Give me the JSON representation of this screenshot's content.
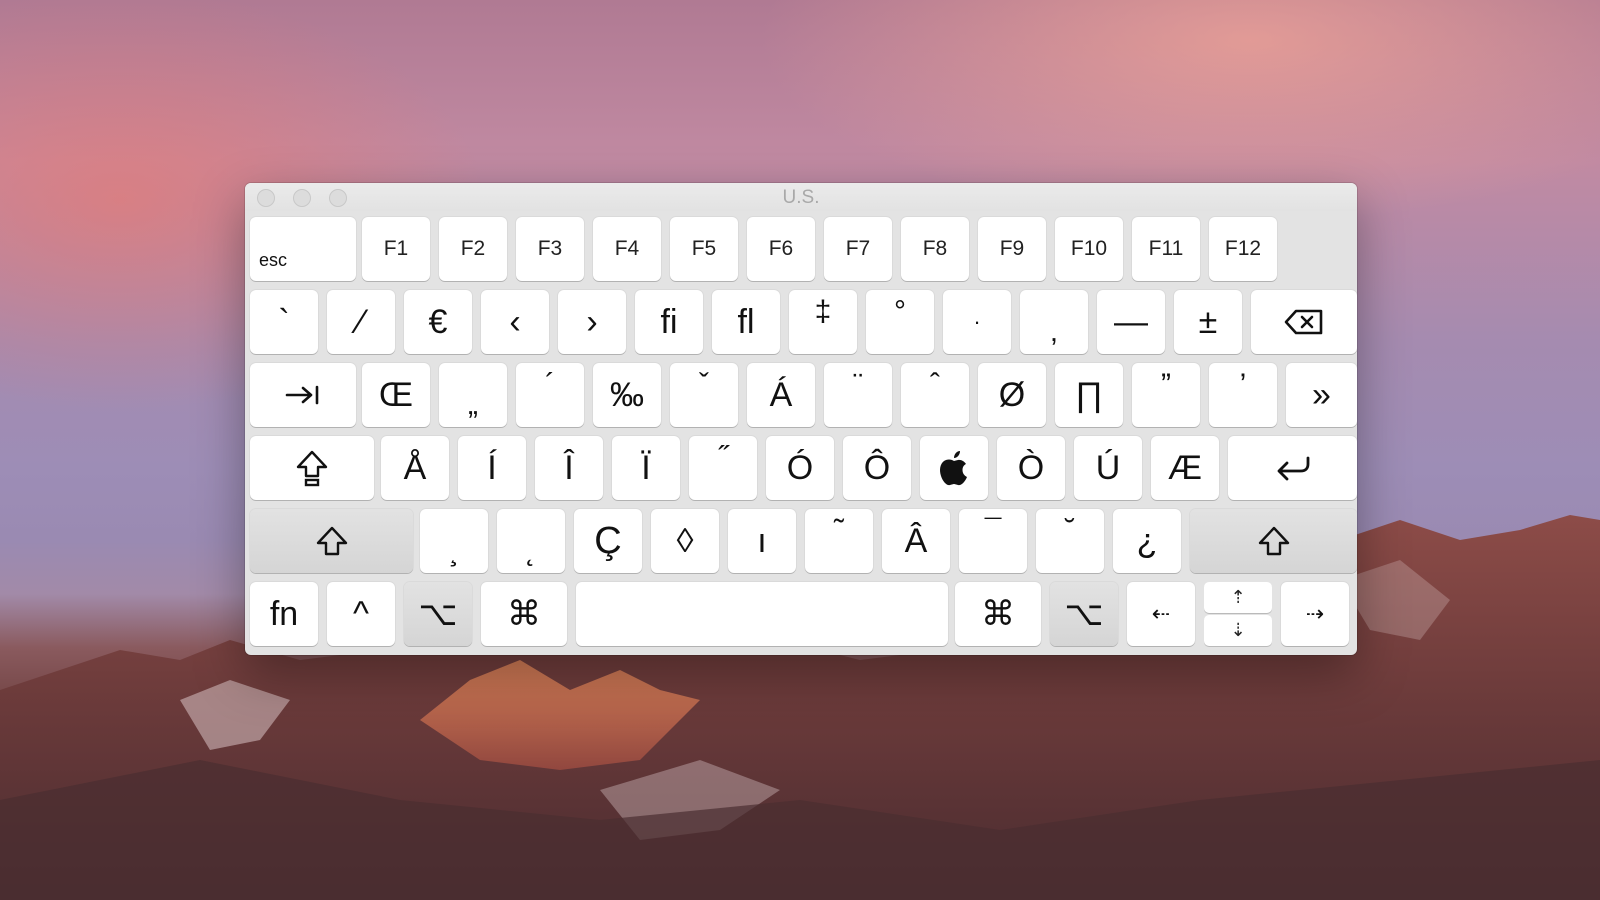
{
  "window": {
    "title": "U.S."
  },
  "keyboard": {
    "row_function": [
      {
        "label": "esc",
        "name": "esc-key"
      },
      {
        "label": "F1",
        "name": "f1-key"
      },
      {
        "label": "F2",
        "name": "f2-key"
      },
      {
        "label": "F3",
        "name": "f3-key"
      },
      {
        "label": "F4",
        "name": "f4-key"
      },
      {
        "label": "F5",
        "name": "f5-key"
      },
      {
        "label": "F6",
        "name": "f6-key"
      },
      {
        "label": "F7",
        "name": "f7-key"
      },
      {
        "label": "F8",
        "name": "f8-key"
      },
      {
        "label": "F9",
        "name": "f9-key"
      },
      {
        "label": "F10",
        "name": "f10-key"
      },
      {
        "label": "F11",
        "name": "f11-key"
      },
      {
        "label": "F12",
        "name": "f12-key"
      }
    ],
    "row_number": [
      "`",
      "⁄",
      "€",
      "‹",
      "›",
      "ﬁ",
      "ﬂ",
      "‡",
      "°",
      "·",
      "‚",
      "—",
      "±"
    ],
    "row_top": [
      "Œ",
      "„",
      "´",
      "‰",
      "ˇ",
      "Á",
      "¨",
      "ˆ",
      "Ø",
      "∏",
      "”",
      "’",
      "»"
    ],
    "row_home": [
      "Å",
      "Í",
      "Î",
      "Ï",
      "˝",
      "Ó",
      "Ô",
      "",
      "Ò",
      "Ú",
      "Æ"
    ],
    "row_bottom": [
      "¸",
      "˛",
      "Ç",
      "◊",
      "ı",
      "˜",
      "Â",
      "¯",
      "˘",
      "¿"
    ],
    "row_modifiers": {
      "fn": "fn",
      "control": "^",
      "option_left": "⌥",
      "command_left": "⌘",
      "command_right": "⌘",
      "option_right": "⌥",
      "arrow_left": "⇠",
      "arrow_up": "⇡",
      "arrow_down": "⇣",
      "arrow_right": "⇢"
    },
    "icons": {
      "delete": "delete-icon",
      "tab": "tab-icon",
      "caps_lock": "caps-lock-icon",
      "return": "return-icon",
      "shift": "shift-icon",
      "apple": "apple-logo-icon"
    }
  }
}
